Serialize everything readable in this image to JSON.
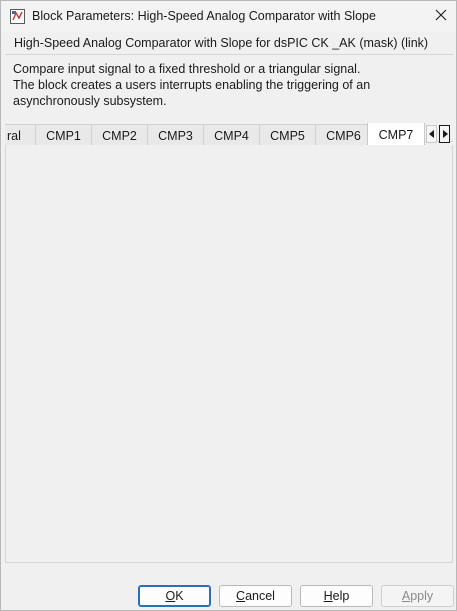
{
  "window": {
    "title": "Block Parameters: High-Speed Analog Comparator with Slope"
  },
  "mask": {
    "title": "High-Speed Analog Comparator with Slope for dsPIC CK _AK (mask) (link)",
    "description_lines": [
      "Compare input signal to a fixed threshold or a triangular signal.",
      "The block creates a users interrupts enabling the triggering of an",
      "asynchronously subsystem."
    ]
  },
  "tabs": [
    {
      "label": "ral",
      "active": false
    },
    {
      "label": "CMP1",
      "active": false
    },
    {
      "label": "CMP2",
      "active": false
    },
    {
      "label": "CMP3",
      "active": false
    },
    {
      "label": "CMP4",
      "active": false
    },
    {
      "label": "CMP5",
      "active": false
    },
    {
      "label": "CMP6",
      "active": false
    },
    {
      "label": "CMP7",
      "active": true
    }
  ],
  "buttons": {
    "ok": {
      "first": "O",
      "rest": "K"
    },
    "cancel": {
      "first": "C",
      "rest": "ancel"
    },
    "help": {
      "first": "H",
      "rest": "elp"
    },
    "apply": {
      "first": "A",
      "rest": "pply",
      "enabled": false
    }
  },
  "icons": {
    "app": "simulink-block-icon",
    "close": "close-icon",
    "tab_left": "arrow-left-icon",
    "tab_right": "arrow-right-icon"
  }
}
